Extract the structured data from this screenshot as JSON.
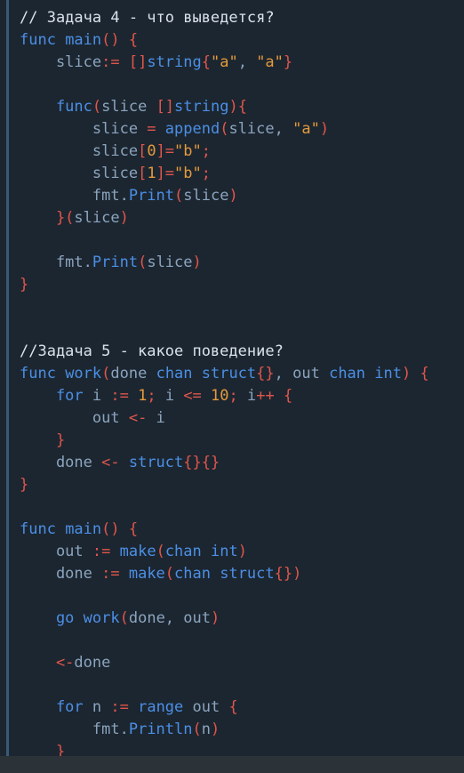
{
  "lines": [
    [
      [
        "cmt",
        "// Задача 4 - что выведется?"
      ]
    ],
    [
      [
        "kw",
        "func "
      ],
      [
        "fn",
        "main"
      ],
      [
        "pun",
        "() {"
      ]
    ],
    [
      [
        "id",
        "    slice"
      ],
      [
        "pun",
        ":= []"
      ],
      [
        "kw",
        "string"
      ],
      [
        "pun",
        "{"
      ],
      [
        "str",
        "\"a\""
      ],
      [
        "id",
        ", "
      ],
      [
        "str",
        "\"a\""
      ],
      [
        "pun",
        "}"
      ]
    ],
    [
      [
        "id",
        ""
      ]
    ],
    [
      [
        "kw",
        "    func"
      ],
      [
        "pun",
        "("
      ],
      [
        "id",
        "slice "
      ],
      [
        "pun",
        "[]"
      ],
      [
        "kw",
        "string"
      ],
      [
        "pun",
        "){"
      ]
    ],
    [
      [
        "id",
        "        slice "
      ],
      [
        "pun",
        "= "
      ],
      [
        "fn",
        "append"
      ],
      [
        "pun",
        "("
      ],
      [
        "id",
        "slice, "
      ],
      [
        "str",
        "\"a\""
      ],
      [
        "pun",
        ")"
      ]
    ],
    [
      [
        "id",
        "        slice"
      ],
      [
        "pun",
        "["
      ],
      [
        "num",
        "0"
      ],
      [
        "pun",
        "]="
      ],
      [
        "str",
        "\"b\""
      ],
      [
        "pun",
        ";"
      ]
    ],
    [
      [
        "id",
        "        slice"
      ],
      [
        "pun",
        "["
      ],
      [
        "num",
        "1"
      ],
      [
        "pun",
        "]="
      ],
      [
        "str",
        "\"b\""
      ],
      [
        "pun",
        ";"
      ]
    ],
    [
      [
        "id",
        "        fmt."
      ],
      [
        "fn",
        "Print"
      ],
      [
        "pun",
        "("
      ],
      [
        "id",
        "slice"
      ],
      [
        "pun",
        ")"
      ]
    ],
    [
      [
        "pun",
        "    }("
      ],
      [
        "id",
        "slice"
      ],
      [
        "pun",
        ")"
      ]
    ],
    [
      [
        "id",
        ""
      ]
    ],
    [
      [
        "id",
        "    fmt."
      ],
      [
        "fn",
        "Print"
      ],
      [
        "pun",
        "("
      ],
      [
        "id",
        "slice"
      ],
      [
        "pun",
        ")"
      ]
    ],
    [
      [
        "pun",
        "}"
      ]
    ],
    [
      [
        "id",
        ""
      ]
    ],
    [
      [
        "id",
        ""
      ]
    ],
    [
      [
        "cmt",
        "//Задача 5 - какое поведение?"
      ]
    ],
    [
      [
        "kw",
        "func "
      ],
      [
        "fn",
        "work"
      ],
      [
        "pun",
        "("
      ],
      [
        "id",
        "done "
      ],
      [
        "kw",
        "chan struct"
      ],
      [
        "pun",
        "{}"
      ],
      [
        "id",
        ", out "
      ],
      [
        "kw",
        "chan int"
      ],
      [
        "pun",
        ") {"
      ]
    ],
    [
      [
        "kw",
        "    for "
      ],
      [
        "id",
        "i "
      ],
      [
        "pun",
        ":= "
      ],
      [
        "num",
        "1"
      ],
      [
        "pun",
        "; "
      ],
      [
        "id",
        "i "
      ],
      [
        "pun",
        "<= "
      ],
      [
        "num",
        "10"
      ],
      [
        "pun",
        "; "
      ],
      [
        "id",
        "i"
      ],
      [
        "pun",
        "++ {"
      ]
    ],
    [
      [
        "id",
        "        out "
      ],
      [
        "pun",
        "<- "
      ],
      [
        "id",
        "i"
      ]
    ],
    [
      [
        "pun",
        "    }"
      ]
    ],
    [
      [
        "id",
        "    done "
      ],
      [
        "pun",
        "<- "
      ],
      [
        "kw",
        "struct"
      ],
      [
        "pun",
        "{}{}"
      ]
    ],
    [
      [
        "pun",
        "}"
      ]
    ],
    [
      [
        "id",
        ""
      ]
    ],
    [
      [
        "kw",
        "func "
      ],
      [
        "fn",
        "main"
      ],
      [
        "pun",
        "() {"
      ]
    ],
    [
      [
        "id",
        "    out "
      ],
      [
        "pun",
        ":= "
      ],
      [
        "fn",
        "make"
      ],
      [
        "pun",
        "("
      ],
      [
        "kw",
        "chan int"
      ],
      [
        "pun",
        ")"
      ]
    ],
    [
      [
        "id",
        "    done "
      ],
      [
        "pun",
        ":= "
      ],
      [
        "fn",
        "make"
      ],
      [
        "pun",
        "("
      ],
      [
        "kw",
        "chan struct"
      ],
      [
        "pun",
        "{})"
      ]
    ],
    [
      [
        "id",
        ""
      ]
    ],
    [
      [
        "kw",
        "    go "
      ],
      [
        "fn",
        "work"
      ],
      [
        "pun",
        "("
      ],
      [
        "id",
        "done, out"
      ],
      [
        "pun",
        ")"
      ]
    ],
    [
      [
        "id",
        ""
      ]
    ],
    [
      [
        "pun",
        "    <-"
      ],
      [
        "id",
        "done"
      ]
    ],
    [
      [
        "id",
        ""
      ]
    ],
    [
      [
        "kw",
        "    for "
      ],
      [
        "id",
        "n "
      ],
      [
        "pun",
        ":= "
      ],
      [
        "kw",
        "range "
      ],
      [
        "id",
        "out "
      ],
      [
        "pun",
        "{"
      ]
    ],
    [
      [
        "id",
        "        fmt."
      ],
      [
        "fn",
        "Println"
      ],
      [
        "pun",
        "("
      ],
      [
        "id",
        "n"
      ],
      [
        "pun",
        ")"
      ]
    ],
    [
      [
        "pun",
        "    }"
      ]
    ]
  ]
}
